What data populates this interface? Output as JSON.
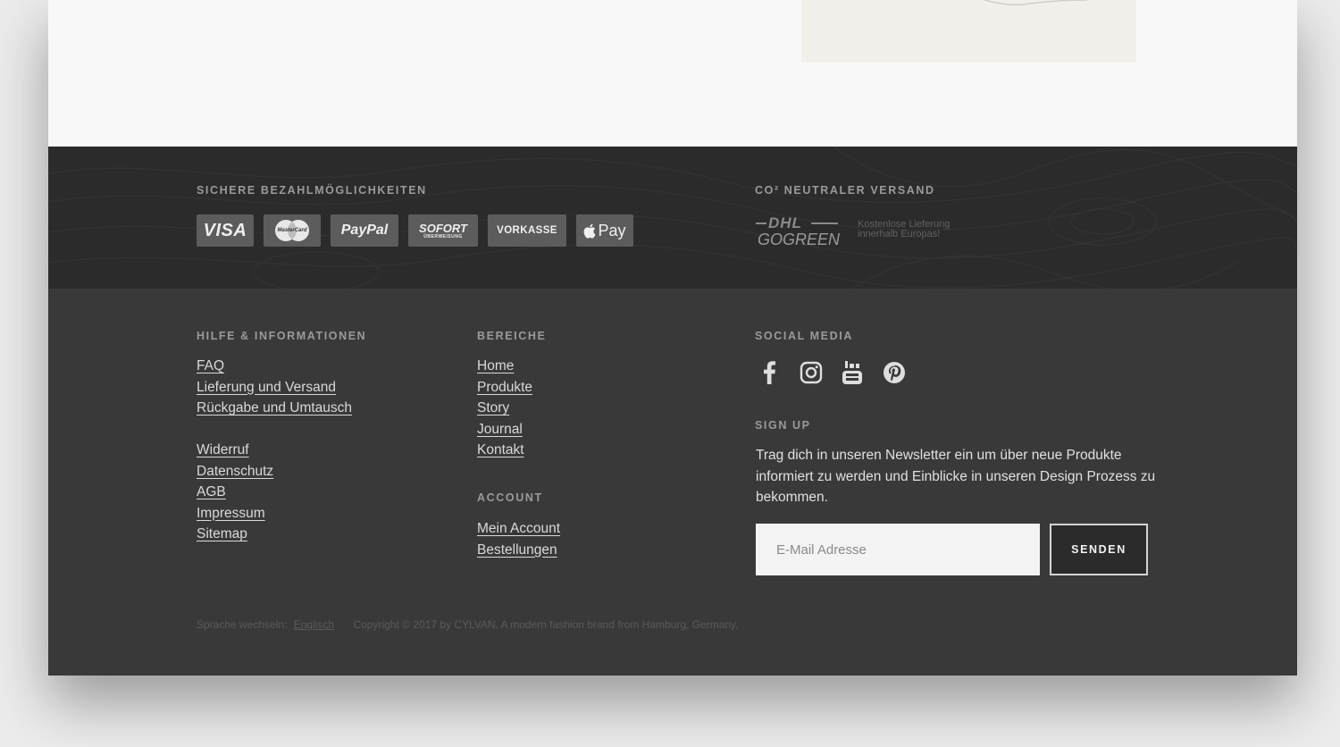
{
  "payments": {
    "heading": "SICHERE BEZAHLMÖGLICHKEITEN",
    "methods": {
      "visa": "VISA",
      "mastercard": "MasterCard",
      "paypal": "PayPal",
      "sofort_main": "SOFORT",
      "sofort_sub": "ÜBERWEISUNG",
      "vorkasse": "VORKASSE",
      "applepay": "Pay"
    }
  },
  "shipping": {
    "heading": "CO² NEUTRALER VERSAND",
    "logo_top": "DHL",
    "logo_bottom": "GOGREEN",
    "note_line1": "Kostenlose Lieferung",
    "note_line2": "innerhalb Europas!"
  },
  "help": {
    "heading": "HILFE & INFORMATIONEN",
    "links": [
      "FAQ",
      "Lieferung und Versand",
      "Rückgabe und Umtausch",
      "Widerruf",
      "Datenschutz",
      "AGB",
      "Impressum",
      "Sitemap"
    ]
  },
  "sections": {
    "heading": "BEREICHE",
    "links": [
      "Home",
      "Produkte",
      "Story",
      "Journal",
      "Kontakt"
    ]
  },
  "account": {
    "heading": "ACCOUNT",
    "links": [
      "Mein Account",
      "Bestellungen"
    ]
  },
  "social": {
    "heading": "SOCIAL MEDIA",
    "icons": [
      "facebook-icon",
      "instagram-icon",
      "youtube-icon",
      "pinterest-icon"
    ]
  },
  "signup": {
    "heading": "SIGN UP",
    "text": "Trag dich in unseren Newsletter ein um über neue Produkte informiert zu werden und Einblicke in unseren Design Prozess zu bekommen.",
    "placeholder": "E-Mail Adresse",
    "button": "SENDEN"
  },
  "bottom": {
    "language_label": "Sprache wechseln:",
    "language_link": "Englisch",
    "copyright": "Copyright © 2017 by CYLVAN. A modern fashion brand from Hamburg, Germany."
  },
  "colors": {
    "payment_band": "#2b2b2b",
    "footer": "#393939",
    "content": "#f8f8f8",
    "page_bg": "#ececec"
  }
}
